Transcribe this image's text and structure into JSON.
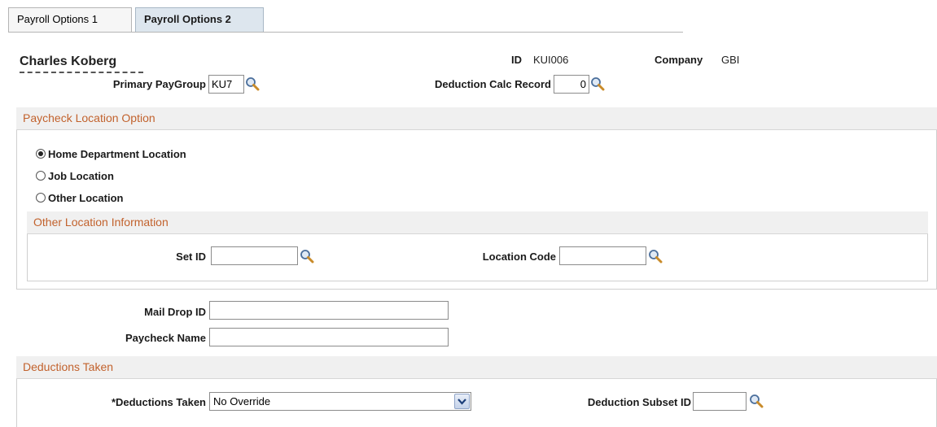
{
  "tabs": [
    {
      "label": "Payroll Options 1",
      "active": false
    },
    {
      "label": "Payroll Options 2",
      "active": true
    }
  ],
  "employee": {
    "name": "Charles Koberg",
    "id_label": "ID",
    "id_value": "KUI006",
    "company_label": "Company",
    "company_value": "GBI"
  },
  "fields": {
    "primary_paygroup_label": "Primary PayGroup",
    "primary_paygroup_value": "KU7",
    "deduction_calc_label": "Deduction Calc Record",
    "deduction_calc_value": "0",
    "mail_drop_label": "Mail Drop ID",
    "mail_drop_value": "",
    "paycheck_name_label": "Paycheck Name",
    "paycheck_name_value": ""
  },
  "paycheck_location": {
    "title": "Paycheck Location Option",
    "options": [
      {
        "label": "Home Department Location",
        "selected": true
      },
      {
        "label": "Job Location",
        "selected": false
      },
      {
        "label": "Other Location",
        "selected": false
      }
    ],
    "other_info": {
      "title": "Other Location Information",
      "setid_label": "Set ID",
      "setid_value": "",
      "location_code_label": "Location Code",
      "location_code_value": ""
    }
  },
  "deductions": {
    "title": "Deductions Taken",
    "taken_label": "*Deductions Taken",
    "taken_value": "No Override",
    "subset_label": "Deduction Subset ID",
    "subset_value": ""
  },
  "colors": {
    "section_title": "#c2622d",
    "active_tab": "#dde6ee"
  },
  "icons": {
    "lookup": "magnifier-icon",
    "dropdown": "chevron-down-icon"
  }
}
